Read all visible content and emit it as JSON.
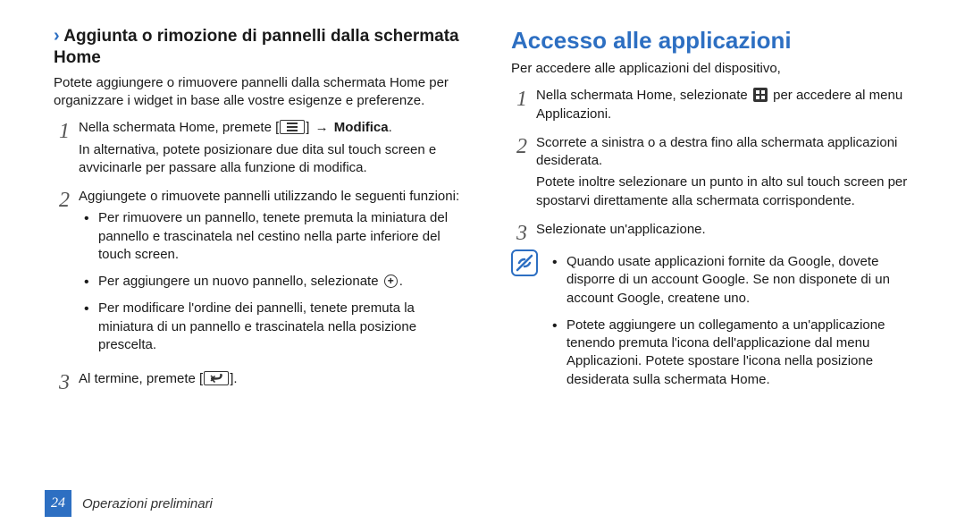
{
  "left": {
    "heading": "Aggiunta o rimozione di pannelli dalla schermata Home",
    "intro": "Potete aggiungere o rimuovere pannelli dalla schermata Home per organizzare i widget in base alle vostre esigenze e preferenze.",
    "step1_a": "Nella schermata Home, premete [",
    "step1_b": "] ",
    "step1_bold": "Modifica",
    "step1_c": ".",
    "step1_extra": "In alternativa, potete posizionare due dita sul touch screen e avvicinarle per passare alla funzione di modifica.",
    "step2": "Aggiungete o rimuovete pannelli utilizzando le seguenti funzioni:",
    "bullet1": "Per rimuovere un pannello, tenete premuta la miniatura del pannello e trascinatela nel cestino nella parte inferiore del touch screen.",
    "bullet2_a": "Per aggiungere un nuovo pannello, selezionate ",
    "bullet2_b": ".",
    "bullet3": "Per modificare l'ordine dei pannelli, tenete premuta la miniatura di un pannello e trascinatela nella posizione prescelta.",
    "step3_a": "Al termine, premete [",
    "step3_b": "]."
  },
  "right": {
    "title": "Accesso alle applicazioni",
    "intro": "Per accedere alle applicazioni del dispositivo,",
    "step1_a": "Nella schermata Home, selezionate ",
    "step1_b": " per accedere al menu Applicazioni.",
    "step2": "Scorrete a sinistra o a destra fino alla schermata applicazioni desiderata.",
    "step2_extra": "Potete inoltre selezionare un punto in alto sul touch screen per spostarvi direttamente alla schermata corrispondente.",
    "step3": "Selezionate un'applicazione.",
    "note1": "Quando usate applicazioni fornite da Google, dovete disporre di un account Google. Se non disponete di un account Google, createne uno.",
    "note2": "Potete aggiungere un collegamento a un'applicazione tenendo premuta l'icona dell'applicazione dal menu Applicazioni. Potete spostare l'icona nella posizione desiderata sulla schermata Home."
  },
  "footer": {
    "page": "24",
    "section": "Operazioni preliminari"
  },
  "symbols": {
    "arrow": "→",
    "plus": "+"
  }
}
